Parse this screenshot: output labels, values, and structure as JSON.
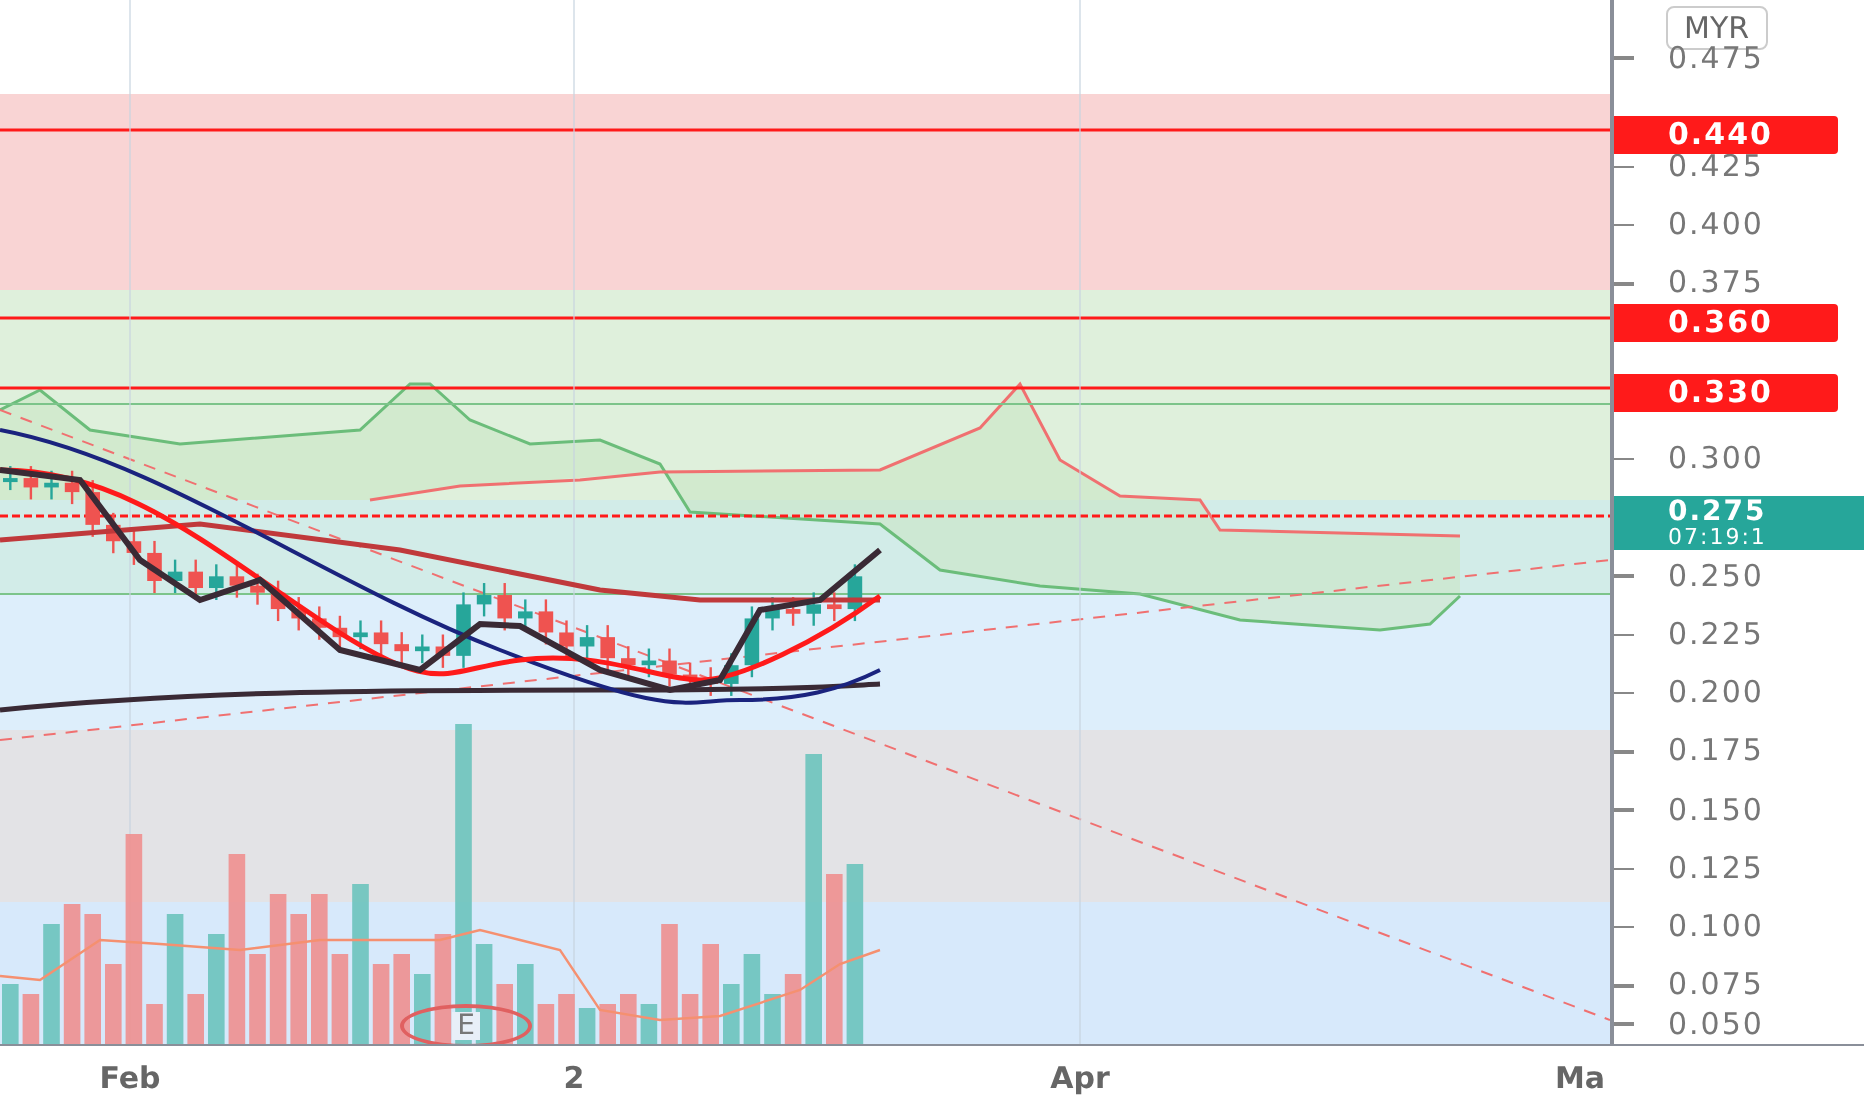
{
  "price_axis": {
    "currency": "MYR",
    "ticks": [
      {
        "label": "0.475"
      },
      {
        "label": "0.425"
      },
      {
        "label": "0.400"
      },
      {
        "label": "0.375"
      },
      {
        "label": "0.300"
      },
      {
        "label": "0.250"
      },
      {
        "label": "0.225"
      },
      {
        "label": "0.200"
      },
      {
        "label": "0.175"
      },
      {
        "label": "0.150"
      },
      {
        "label": "0.125"
      },
      {
        "label": "0.100"
      },
      {
        "label": "0.075"
      },
      {
        "label": "0.050"
      }
    ]
  },
  "price_tags": [
    {
      "value": "0.440",
      "color": "#ff1a1a"
    },
    {
      "value": "0.360",
      "color": "#ff1a1a"
    },
    {
      "value": "0.330",
      "color": "#ff1a1a"
    },
    {
      "value": "0.275",
      "countdown": "07:19:1",
      "color": "#26a69a"
    }
  ],
  "time_axis": {
    "labels": [
      "Feb",
      "2",
      "Apr",
      "Ma"
    ]
  },
  "earnings_marker": "E"
}
